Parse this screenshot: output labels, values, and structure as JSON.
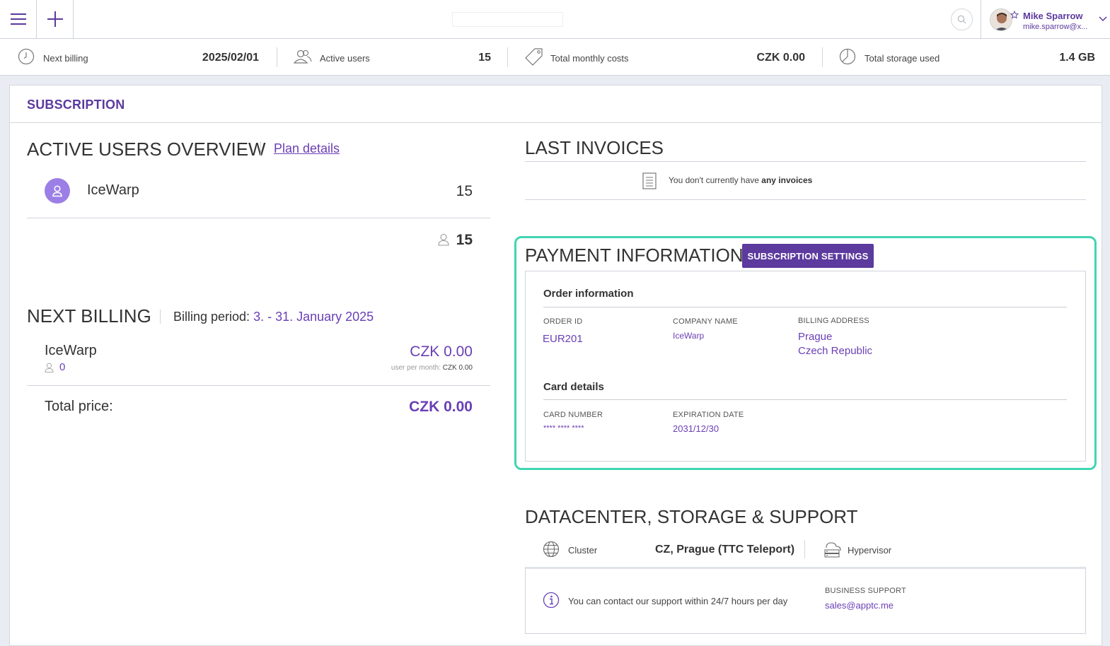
{
  "topbar": {
    "user_name": "Mike Sparrow",
    "user_email": "mike.sparrow@x..."
  },
  "stats": {
    "next_billing_label": "Next billing",
    "next_billing_value": "2025/02/01",
    "active_users_label": "Active users",
    "active_users_value": "15",
    "monthly_costs_label": "Total monthly costs",
    "monthly_costs_value": "CZK 0.00",
    "storage_label": "Total storage used",
    "storage_value": "1.4 GB"
  },
  "page": {
    "title": "SUBSCRIPTION"
  },
  "active_users": {
    "title": "ACTIVE USERS OVERVIEW",
    "plan_details_link": "Plan details",
    "rows": [
      {
        "name": "IceWarp",
        "count": "15"
      }
    ],
    "total": "15"
  },
  "next_billing": {
    "title": "NEXT BILLING",
    "period_label": "Billing period:",
    "period_value": "3. - 31. January 2025",
    "item_name": "IceWarp",
    "item_users": "0",
    "item_price": "CZK 0.00",
    "per_month_label": "user per month:",
    "per_month_value": "CZK 0.00",
    "total_label": "Total price:",
    "total_value": "CZK 0.00"
  },
  "invoices": {
    "title": "LAST INVOICES",
    "empty_prefix": "You don't currently have",
    "empty_bold": "any invoices"
  },
  "payment": {
    "title": "PAYMENT INFORMATION",
    "settings_button": "SUBSCRIPTION SETTINGS",
    "order_heading": "Order information",
    "order_id_label": "ORDER ID",
    "order_id_value": "EUR201",
    "company_label": "COMPANY NAME",
    "company_value": "IceWarp",
    "address_label": "BILLING ADDRESS",
    "address_line1": "Prague",
    "address_line2": "Czech Republic",
    "card_heading": "Card details",
    "card_number_label": "CARD NUMBER",
    "card_number_value": "**** **** ****",
    "expiration_label": "EXPIRATION DATE",
    "expiration_value": "2031/12/30"
  },
  "datacenter": {
    "title": "DATACENTER, STORAGE & SUPPORT",
    "cluster_label": "Cluster",
    "cluster_value": "CZ, Prague (TTC Teleport)",
    "hypervisor_label": "Hypervisor",
    "support_text": "You can contact our support within 24/7 hours per day",
    "business_support_label": "BUSINESS SUPPORT",
    "business_support_email": "sales@apptc.me"
  },
  "colors": {
    "accent": "#5c3a9e",
    "link": "#6a3fb5",
    "highlight": "#3fd6b2",
    "avatar_bg": "#9b7fe6"
  }
}
